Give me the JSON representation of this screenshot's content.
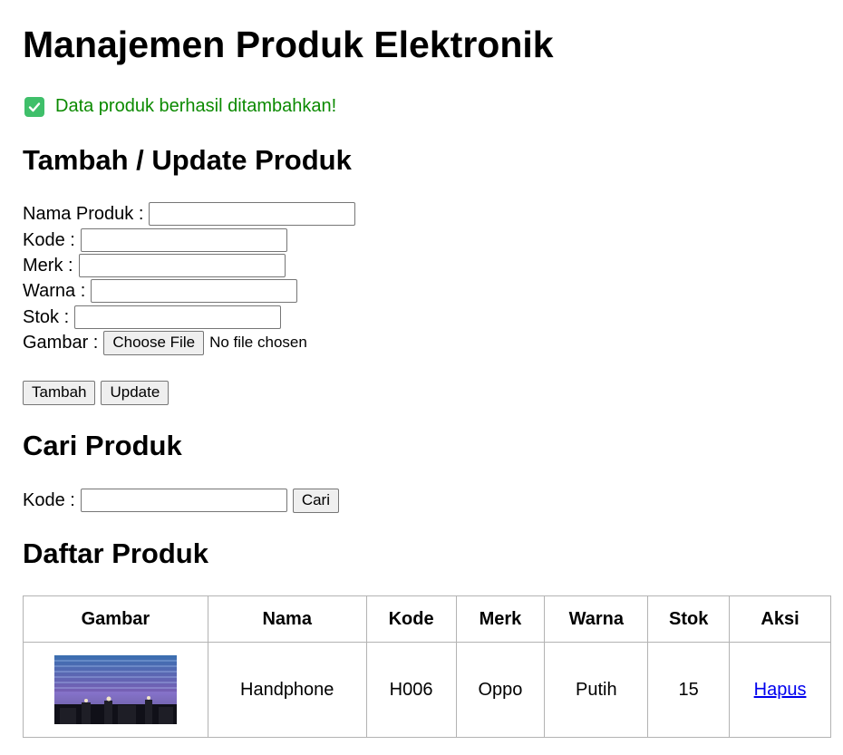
{
  "page_title": "Manajemen Produk Elektronik",
  "success_message": "Data produk berhasil ditambahkan!",
  "form": {
    "heading": "Tambah / Update Produk",
    "fields": {
      "nama_label": "Nama Produk :",
      "kode_label": "Kode :",
      "merk_label": "Merk :",
      "warna_label": "Warna :",
      "stok_label": "Stok :",
      "gambar_label": "Gambar :"
    },
    "file_button": "Choose File",
    "file_status": "No file chosen",
    "tambah_button": "Tambah",
    "update_button": "Update"
  },
  "search": {
    "heading": "Cari Produk",
    "kode_label": "Kode :",
    "button": "Cari"
  },
  "list": {
    "heading": "Daftar Produk",
    "columns": [
      "Gambar",
      "Nama",
      "Kode",
      "Merk",
      "Warna",
      "Stok",
      "Aksi"
    ],
    "rows": [
      {
        "image_icon": "concert-stage-photo",
        "nama": "Handphone",
        "kode": "H006",
        "merk": "Oppo",
        "warna": "Putih",
        "stok": "15",
        "aksi": "Hapus"
      }
    ]
  },
  "colors": {
    "success_text": "#0b8a00",
    "success_icon": "#3fbf6a",
    "link": "#0000ee",
    "table_border": "#b3b3b3"
  }
}
